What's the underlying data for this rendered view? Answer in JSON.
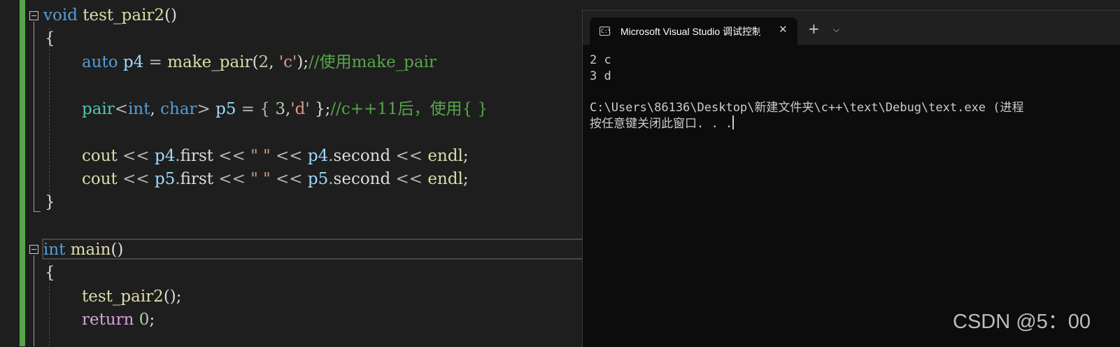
{
  "editor": {
    "lines": {
      "l1": {
        "kw": "void",
        "sp": " ",
        "fn": "test_pair2",
        "paren": "()"
      },
      "l2": {
        "brace": "{"
      },
      "l3": {
        "kw": "auto",
        "sp1": " ",
        "var": "p4",
        "eq": " = ",
        "fn": "make_pair",
        "open": "(",
        "num": "2",
        "comma": ", ",
        "str": "'c'",
        "close": ");",
        "cmt": "//使用make_pair"
      },
      "l4": {
        "ty": "pair",
        "lt": "<",
        "kw1": "int",
        "comma": ", ",
        "kw2": "char",
        "gt": ">",
        "sp": " ",
        "var": "p5",
        "eq": " = { ",
        "num": "3",
        "comma2": ",",
        "str": "'d'",
        "close": " };",
        "cmt": "//c++11后，使用{ }"
      },
      "l5": {
        "fn": "cout",
        "op1": " << ",
        "var1": "p4",
        "dot1": ".",
        "m1": "first",
        "op2": " << ",
        "str": "\" \"",
        "op3": " << ",
        "var2": "p4",
        "dot2": ".",
        "m2": "second",
        "op4": " << ",
        "fn2": "endl",
        "semi": ";"
      },
      "l6": {
        "fn": "cout",
        "op1": " << ",
        "var1": "p5",
        "dot1": ".",
        "m1": "first",
        "op2": " << ",
        "str": "\" \"",
        "op3": " << ",
        "var2": "p5",
        "dot2": ".",
        "m2": "second",
        "op4": " << ",
        "fn2": "endl",
        "semi": ";"
      },
      "l7": {
        "brace": "}"
      },
      "l8": {
        "kw": "int",
        "sp": " ",
        "fn": "main",
        "paren": "()"
      },
      "l9": {
        "brace": "{"
      },
      "l10": {
        "fn": "test_pair2",
        "rest": "();"
      },
      "l11": {
        "kw": "return",
        "sp": " ",
        "num": "0",
        "semi": ";"
      }
    },
    "colors": {
      "keyword": "#569cd6",
      "function": "#dcdcaa",
      "variable": "#9cdcfe",
      "number": "#b5cea8",
      "string": "#d69d85",
      "comment": "#57a64a",
      "type": "#4ec9b0",
      "control": "#d8a0df",
      "change_bar": "#57a64a"
    }
  },
  "terminal": {
    "tab_title": "Microsoft Visual Studio 调试控制台",
    "tab_icon": "terminal-icon",
    "tab_icon_text": "C:\\",
    "close_symbol": "✕",
    "new_tab_symbol": "+",
    "dropdown_symbol": "⌵",
    "output": [
      "2 c",
      "3 d",
      "",
      "C:\\Users\\86136\\Desktop\\新建文件夹\\c++\\text\\Debug\\text.exe (进程",
      "按任意键关闭此窗口. . ."
    ]
  },
  "watermark": "CSDN @5：00"
}
